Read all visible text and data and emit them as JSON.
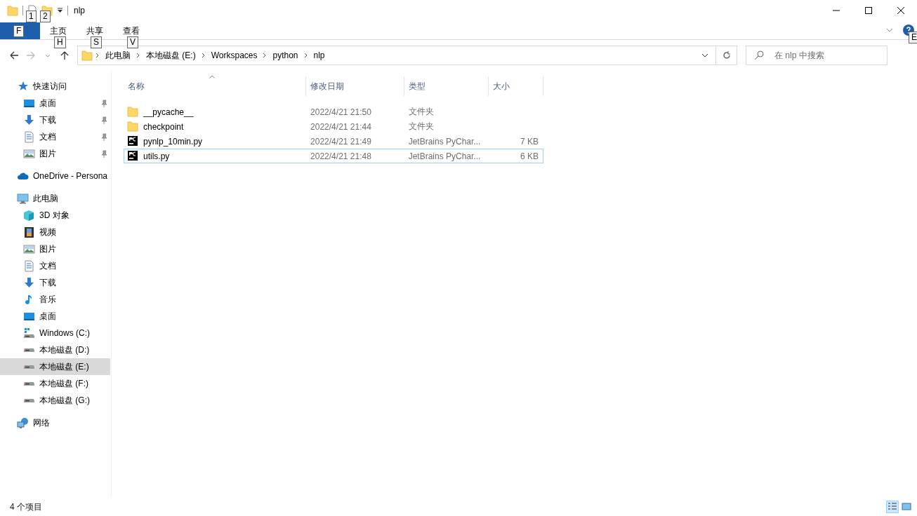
{
  "title_bar": {
    "title": "nlp",
    "keytips": [
      "1",
      "2"
    ]
  },
  "ribbon": {
    "tabs": [
      {
        "keytip": "F",
        "kind": "file"
      },
      {
        "label": "主页",
        "keytip": "H",
        "kind": "tab"
      },
      {
        "label": "共享",
        "keytip": "S",
        "kind": "tab"
      },
      {
        "label": "查看",
        "keytip": "V",
        "kind": "tab"
      }
    ],
    "help_keytip": "E"
  },
  "address_bar": {
    "path": [
      "此电脑",
      "本地磁盘 (E:)",
      "Workspaces",
      "python",
      "nlp"
    ]
  },
  "search": {
    "placeholder": "在 nlp 中搜索"
  },
  "sidebar": {
    "items": [
      {
        "label": "快速访问",
        "kind": "quick",
        "selected": false,
        "children": [
          {
            "label": "桌面",
            "kind": "desktop",
            "pinned": true,
            "selected": false
          },
          {
            "label": "下载",
            "kind": "download",
            "pinned": true,
            "selected": false
          },
          {
            "label": "文档",
            "kind": "document",
            "pinned": true,
            "selected": false
          },
          {
            "label": "图片",
            "kind": "picture",
            "pinned": true,
            "selected": false
          }
        ]
      },
      {
        "label": "OneDrive - Persona",
        "kind": "onedrive",
        "selected": false
      },
      {
        "label": "此电脑",
        "kind": "pc",
        "selected": false,
        "children": [
          {
            "label": "3D 对象",
            "kind": "cube",
            "selected": false
          },
          {
            "label": "视频",
            "kind": "video",
            "selected": false
          },
          {
            "label": "图片",
            "kind": "picture",
            "selected": false
          },
          {
            "label": "文档",
            "kind": "document",
            "selected": false
          },
          {
            "label": "下载",
            "kind": "download",
            "selected": false
          },
          {
            "label": "音乐",
            "kind": "music",
            "selected": false
          },
          {
            "label": "桌面",
            "kind": "desktop",
            "selected": false
          },
          {
            "label": "Windows (C:)",
            "kind": "windrive",
            "selected": false
          },
          {
            "label": "本地磁盘 (D:)",
            "kind": "drive",
            "selected": false
          },
          {
            "label": "本地磁盘 (E:)",
            "kind": "drive",
            "selected": true
          },
          {
            "label": "本地磁盘 (F:)",
            "kind": "drive",
            "selected": false
          },
          {
            "label": "本地磁盘 (G:)",
            "kind": "drive",
            "selected": false
          }
        ]
      },
      {
        "label": "网络",
        "kind": "network",
        "selected": false
      }
    ]
  },
  "table": {
    "columns": [
      "名称",
      "修改日期",
      "类型",
      "大小"
    ],
    "rows": [
      {
        "kind": "folder",
        "name": "__pycache__",
        "date": "2022/4/21 21:50",
        "type": "文件夹",
        "focused": false
      },
      {
        "kind": "folder",
        "name": "checkpoint",
        "date": "2022/4/21 21:44",
        "type": "文件夹",
        "focused": false
      },
      {
        "kind": "pycharm",
        "name": "pynlp_10min.py",
        "date": "2022/4/21 21:49",
        "type": "JetBrains PyChar...",
        "size": "7 KB",
        "focused": false
      },
      {
        "kind": "pycharm",
        "name": "utils.py",
        "date": "2022/4/21 21:48",
        "type": "JetBrains PyChar...",
        "size": "6 KB",
        "focused": true
      }
    ]
  },
  "status_bar": {
    "item_count": "4 个项目"
  }
}
